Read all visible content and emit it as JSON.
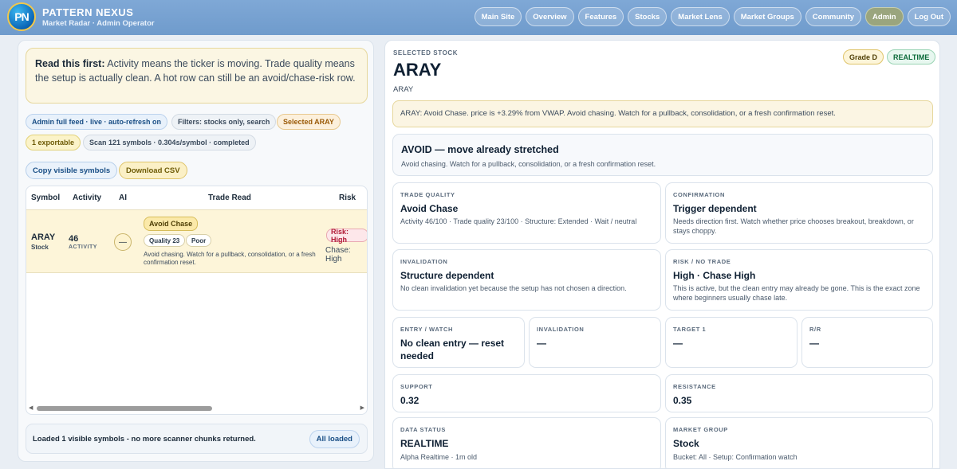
{
  "header": {
    "logo_text": "PN",
    "title": "PATTERN NEXUS",
    "subtitle": "Market Radar · Admin Operator",
    "nav": [
      "Main Site",
      "Overview",
      "Features",
      "Stocks",
      "Market Lens",
      "Market Groups",
      "Community",
      "Admin",
      "Log Out"
    ],
    "active_nav": "Admin"
  },
  "left": {
    "callout_bold": "Read this first:",
    "callout_text": " Activity means the ticker is moving. Trade quality means the setup is actually clean. A hot row can still be an avoid/chase-risk row.",
    "chips": {
      "feed": "Admin full feed · live · auto-refresh on",
      "filters": "Filters: stocks only, search",
      "selected": "Selected ARAY",
      "exportable": "1 exportable",
      "scan": "Scan 121 symbols · 0.304s/symbol · completed"
    },
    "buttons": {
      "copy": "Copy visible symbols",
      "download": "Download CSV"
    },
    "table": {
      "headers": [
        "Symbol",
        "Activity",
        "AI",
        "Trade Read",
        "Risk"
      ],
      "row": {
        "symbol": "ARAY",
        "symbol_type": "Stock",
        "activity": "46",
        "activity_label": "ACTIVITY",
        "ai": "—",
        "trade_tag": "Avoid Chase",
        "quality": "Quality 23",
        "quality_label": "Poor",
        "trade_text": "Avoid chasing. Watch for a pullback, consolidation, or a fresh confirmation reset.",
        "risk_tag": "Risk: High",
        "risk_sub": "Chase: High"
      }
    },
    "loaded_text": "Loaded 1 visible symbols - no more scanner chunks returned.",
    "loaded_button": "All loaded"
  },
  "detail": {
    "eyebrow": "SELECTED STOCK",
    "symbol": "ARAY",
    "symbol_small": "ARAY",
    "grade": "Grade D",
    "status": "REALTIME",
    "note": "ARAY: Avoid Chase. price is +3.29% from VWAP. Avoid chasing. Watch for a pullback, consolidation, or a fresh confirmation reset.",
    "avoid_title": "AVOID — move already stretched",
    "avoid_text": "Avoid chasing. Watch for a pullback, consolidation, or a fresh confirmation reset.",
    "cards": {
      "trade_quality": {
        "cap": "TRADE QUALITY",
        "val": "Avoid Chase",
        "desc": "Activity 46/100 · Trade quality 23/100 · Structure: Extended · Wait / neutral"
      },
      "confirmation": {
        "cap": "CONFIRMATION",
        "val": "Trigger dependent",
        "desc": "Needs direction first. Watch whether price chooses breakout, breakdown, or stays choppy."
      },
      "invalidation": {
        "cap": "INVALIDATION",
        "val": "Structure dependent",
        "desc": "No clean invalidation yet because the setup has not chosen a direction."
      },
      "risk": {
        "cap": "RISK / NO TRADE",
        "val": "High · Chase High",
        "desc": "This is active, but the clean entry may already be gone. This is the exact zone where beginners usually chase late."
      },
      "entry": {
        "cap": "ENTRY / WATCH",
        "val": "No clean entry — reset needed"
      },
      "invalidation2": {
        "cap": "INVALIDATION",
        "val": "—"
      },
      "target": {
        "cap": "TARGET 1",
        "val": "—"
      },
      "rr": {
        "cap": "R/R",
        "val": "—"
      },
      "support": {
        "cap": "SUPPORT",
        "val": "0.32"
      },
      "resistance": {
        "cap": "RESISTANCE",
        "val": "0.35"
      },
      "data_status": {
        "cap": "DATA STATUS",
        "val": "REALTIME",
        "desc": "Alpha Realtime · 1m old"
      },
      "market_group": {
        "cap": "MARKET GROUP",
        "val": "Stock",
        "desc": "Bucket: All · Setup: Confirmation watch"
      }
    }
  }
}
